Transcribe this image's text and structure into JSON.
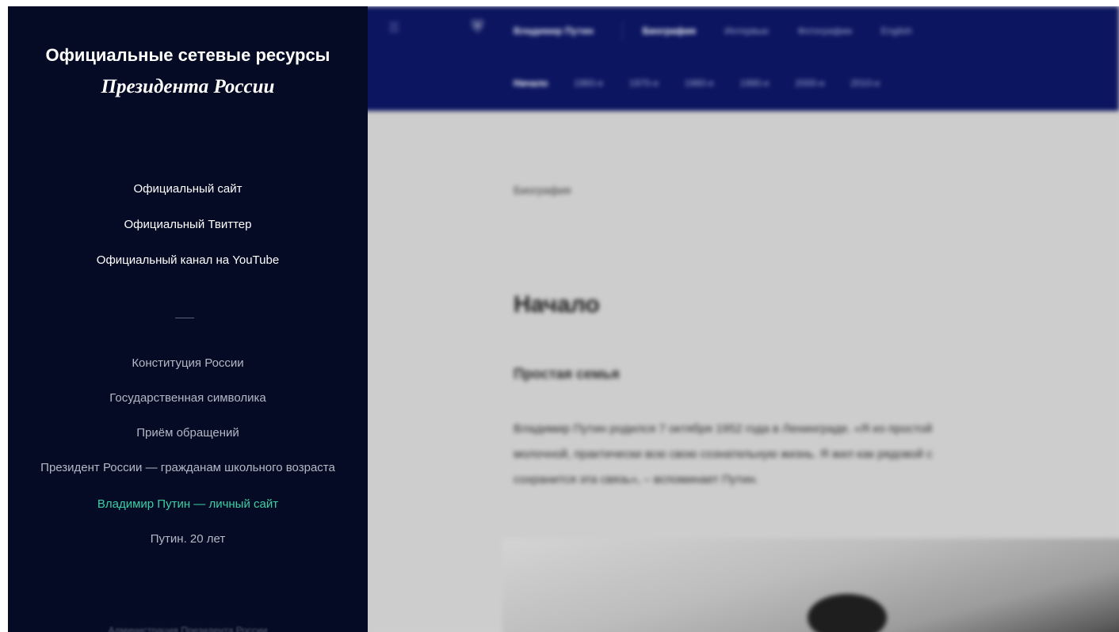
{
  "panel": {
    "title": "Официальные сетевые ресурсы",
    "subtitle": "Президента России",
    "primary_links": [
      "Официальный сайт",
      "Официальный Твиттер",
      "Официальный канал на YouTube"
    ],
    "secondary_links": [
      "Конституция России",
      "Государственная символика",
      "Приём обращений",
      "Президент России — гражданам школьного возраста",
      "Владимир Путин — личный сайт",
      "Путин. 20 лет"
    ],
    "footer": "Администрация Президента России",
    "colors": {
      "background": "#050b24",
      "active_link": "#3ad0a5"
    }
  },
  "site": {
    "header_color": "#0b1560",
    "nav_top": {
      "brand": "Владимир Путин",
      "items": [
        "Биография",
        "Интервью",
        "Фотографии",
        "English"
      ]
    },
    "nav_sub": {
      "items": [
        "Начало",
        "1960-е",
        "1970-е",
        "1980-е",
        "1990-е",
        "2000-е",
        "2010-е"
      ]
    },
    "breadcrumb": "Биография",
    "page_title": "Начало",
    "section_title": "Простая семья",
    "paragraph_lines": [
      "Владимир Путин родился 7 октября 1952 года в Ленинграде. «Я из простой",
      "молочной, практически всю свою сознательную жизнь. Я жил как рядовой с",
      "сохранится эта связь», – вспоминает Путин."
    ]
  }
}
